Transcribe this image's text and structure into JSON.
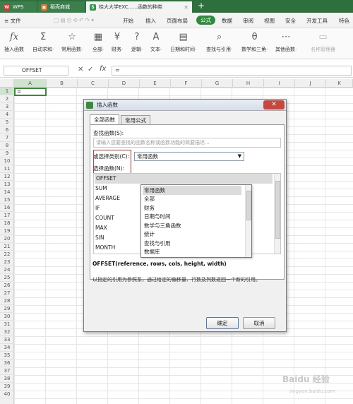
{
  "titlebar": {
    "tabs": [
      {
        "label": "WPS"
      },
      {
        "label": "稻壳商城"
      },
      {
        "label": "桂大大学EXC......函数的种类"
      }
    ],
    "close_glyph": "✕",
    "new_tab_glyph": "+"
  },
  "menubar": {
    "file_label": "≡ 文件",
    "items": [
      "开始",
      "插入",
      "页面布局",
      "公式",
      "数据",
      "审阅",
      "视图",
      "安全",
      "开发工具",
      "特色"
    ],
    "active": "公式"
  },
  "ribbon": {
    "buttons": [
      {
        "label": "插入函数",
        "icon": "fx-icon"
      },
      {
        "label": "自动求和·",
        "icon": "sigma-icon"
      },
      {
        "label": "常用函数·",
        "icon": "star-function-icon"
      },
      {
        "label": "全部·",
        "icon": "all-functions-icon"
      },
      {
        "label": "财务·",
        "icon": "finance-icon"
      },
      {
        "label": "逻辑·",
        "icon": "logic-icon"
      },
      {
        "label": "文本·",
        "icon": "text-icon"
      },
      {
        "label": "日期和时间·",
        "icon": "calendar-icon"
      },
      {
        "label": "查找与引用·",
        "icon": "lookup-icon"
      },
      {
        "label": "数学和三角·",
        "icon": "math-icon"
      },
      {
        "label": "其他函数·",
        "icon": "more-functions-icon"
      },
      {
        "label": "名称管理器",
        "icon": "name-manager-icon"
      }
    ]
  },
  "formula_bar": {
    "name_box": "OFFSET",
    "cancel_glyph": "✕",
    "confirm_glyph": "✓",
    "fx_glyph": "fx",
    "content": "="
  },
  "grid": {
    "columns": [
      "A",
      "B",
      "C",
      "D",
      "E",
      "F",
      "G",
      "H",
      "I",
      "J",
      "K"
    ],
    "rows": [
      "1",
      "2",
      "3",
      "4",
      "5",
      "6",
      "7",
      "8",
      "9",
      "10",
      "11",
      "12",
      "13",
      "14",
      "15",
      "16",
      "17",
      "18",
      "19",
      "20",
      "21",
      "22",
      "23",
      "24",
      "25",
      "26",
      "27",
      "28",
      "29",
      "30",
      "31",
      "32",
      "33",
      "34",
      "35",
      "36",
      "37",
      "38",
      "39",
      "40"
    ],
    "active_cell_value": "="
  },
  "dialog": {
    "title": "插入函数",
    "tabs": [
      "全部函数",
      "常用公式"
    ],
    "search_label": "查找函数(S):",
    "search_placeholder": "请输入您要查找的函数名称或函数功能的简要描述...",
    "category_label": "或选择类别(C):",
    "category_value": "常用函数",
    "function_list_label": "选择函数(N):",
    "functions": [
      "OFFSET",
      "SUM",
      "AVERAGE",
      "IF",
      "COUNT",
      "MAX",
      "SIN",
      "MONTH"
    ],
    "category_options": [
      "常用函数",
      "全部",
      "财务",
      "日期与时间",
      "数学与三角函数",
      "统计",
      "查找与引用",
      "数据库"
    ],
    "signature": "OFFSET(reference, rows, cols, height, width)",
    "description": "以指定的引用为参照系，通过给定的偏移量、行数及列数返回一个新的引用。",
    "ok_label": "确定",
    "cancel_label": "取消"
  },
  "watermark": {
    "text": "Baidu 经验",
    "url": "jingyan.baidu.com"
  }
}
